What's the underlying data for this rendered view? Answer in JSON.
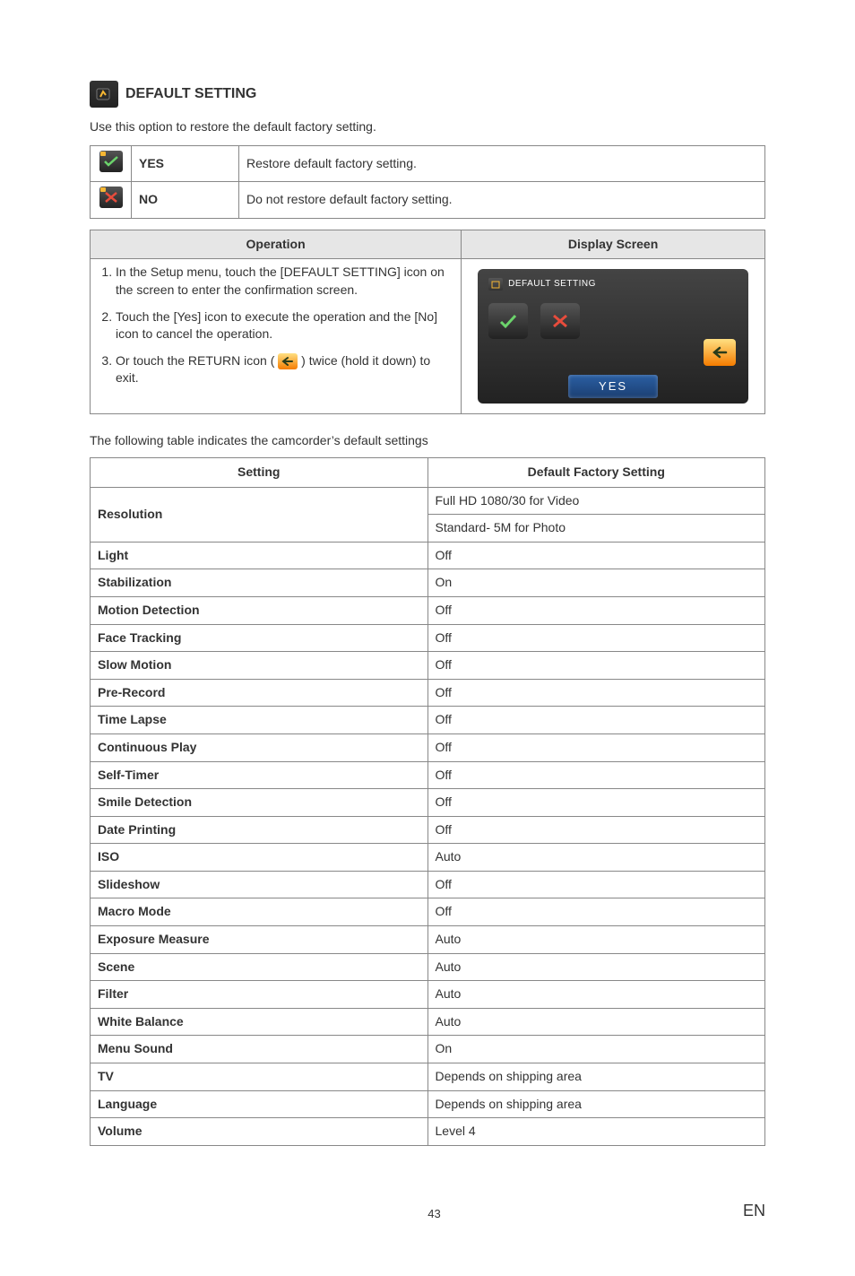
{
  "section_heading": "DEFAULT SETTING",
  "intro": "Use this option to restore the default factory setting.",
  "yesno": {
    "yes_label": "YES",
    "yes_desc": "Restore default factory setting.",
    "no_label": "NO",
    "no_desc": "Do not restore default factory setting."
  },
  "op_header": "Operation",
  "display_header": "Display Screen",
  "steps": [
    "In the Setup menu, touch the [DEFAULT SETTING] icon on the screen to enter the confirmation screen.",
    "Touch the [Yes] icon to execute the operation and the [No] icon to cancel the operation.",
    "Or touch the RETURN icon (        ) twice (hold it down) to exit."
  ],
  "display_mock": {
    "title": "DEFAULT SETTING",
    "yes_bar": "YES"
  },
  "defaults_intro": "The following table indicates the camcorder’s default settings",
  "defaults_headers": {
    "setting": "Setting",
    "value": "Default Factory Setting"
  },
  "defaults": [
    {
      "setting": "Resolution",
      "value": "Full HD 1080/30 for Video",
      "extra": "Standard- 5M for Photo"
    },
    {
      "setting": "Light",
      "value": "Off"
    },
    {
      "setting": "Stabilization",
      "value": "On"
    },
    {
      "setting": "Motion Detection",
      "value": "Off"
    },
    {
      "setting": "Face Tracking",
      "value": "Off"
    },
    {
      "setting": "Slow Motion",
      "value": "Off"
    },
    {
      "setting": "Pre-Record",
      "value": "Off"
    },
    {
      "setting": "Time Lapse",
      "value": "Off"
    },
    {
      "setting": "Continuous Play",
      "value": "Off"
    },
    {
      "setting": "Self-Timer",
      "value": "Off"
    },
    {
      "setting": "Smile Detection",
      "value": "Off"
    },
    {
      "setting": "Date Printing",
      "value": "Off"
    },
    {
      "setting": "ISO",
      "value": "Auto"
    },
    {
      "setting": "Slideshow",
      "value": "Off"
    },
    {
      "setting": "Macro Mode",
      "value": "Off"
    },
    {
      "setting": "Exposure Measure",
      "value": "Auto"
    },
    {
      "setting": "Scene",
      "value": "Auto"
    },
    {
      "setting": "Filter",
      "value": "Auto"
    },
    {
      "setting": "White Balance",
      "value": "Auto"
    },
    {
      "setting": "Menu Sound",
      "value": "On"
    },
    {
      "setting": "TV",
      "value": "Depends on shipping area"
    },
    {
      "setting": "Language",
      "value": "Depends on shipping area"
    },
    {
      "setting": "Volume",
      "value": "Level 4"
    }
  ],
  "page_number": "43",
  "lang_code": "EN"
}
